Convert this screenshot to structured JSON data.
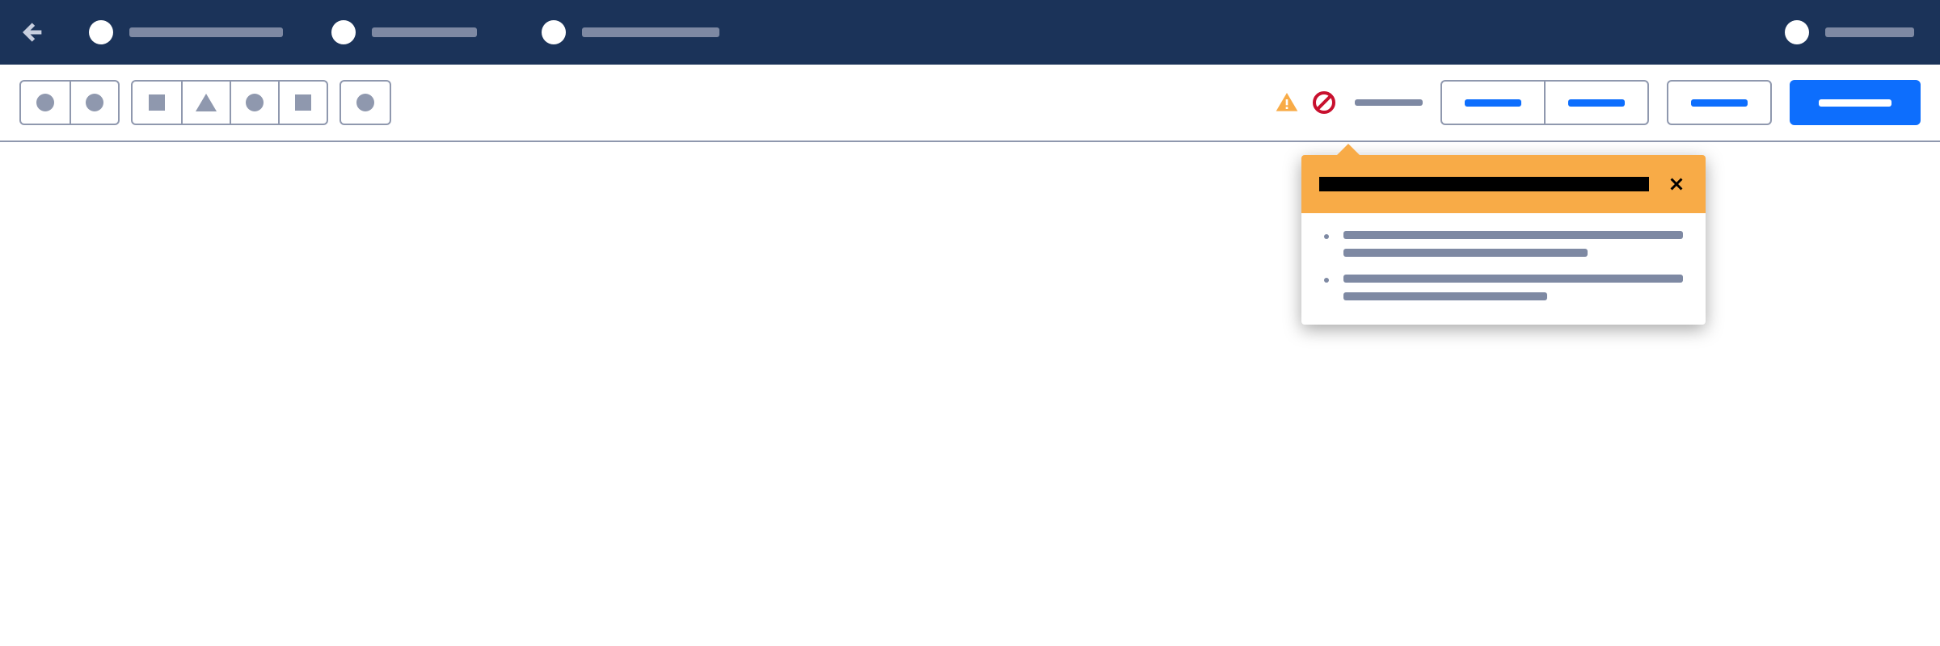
{
  "colors": {
    "navbar_bg": "#1b3359",
    "accent_primary": "#0d6efd",
    "placeholder": "#7e89a3",
    "border": "#8f98ae",
    "warning_bg": "#f8ab47",
    "error_red": "#c8102e",
    "warning_orange": "#f8ab47"
  },
  "topbar": {
    "back_label": "Back",
    "tabs": [
      {
        "label": ""
      },
      {
        "label": ""
      },
      {
        "label": ""
      }
    ],
    "user": {
      "name": ""
    }
  },
  "toolbar": {
    "groups": [
      {
        "tools": [
          {
            "icon": "circle-icon"
          },
          {
            "icon": "circle-icon"
          }
        ]
      },
      {
        "tools": [
          {
            "icon": "square-icon"
          },
          {
            "icon": "triangle-icon"
          },
          {
            "icon": "circle-icon"
          },
          {
            "icon": "square-icon"
          }
        ]
      },
      {
        "tools": [
          {
            "icon": "circle-icon"
          }
        ]
      }
    ],
    "status": {
      "warning_icon": "warning-triangle-icon",
      "error_icon": "prohibit-circle-icon",
      "label": ""
    },
    "segmented": [
      {
        "label": ""
      },
      {
        "label": ""
      }
    ],
    "outline_button": {
      "label": ""
    },
    "primary_button": {
      "label": ""
    }
  },
  "popover": {
    "type": "warning",
    "title": "",
    "close_label": "Close",
    "items": [
      {
        "line1": "",
        "line2": ""
      },
      {
        "line1": "",
        "line2": ""
      }
    ]
  }
}
